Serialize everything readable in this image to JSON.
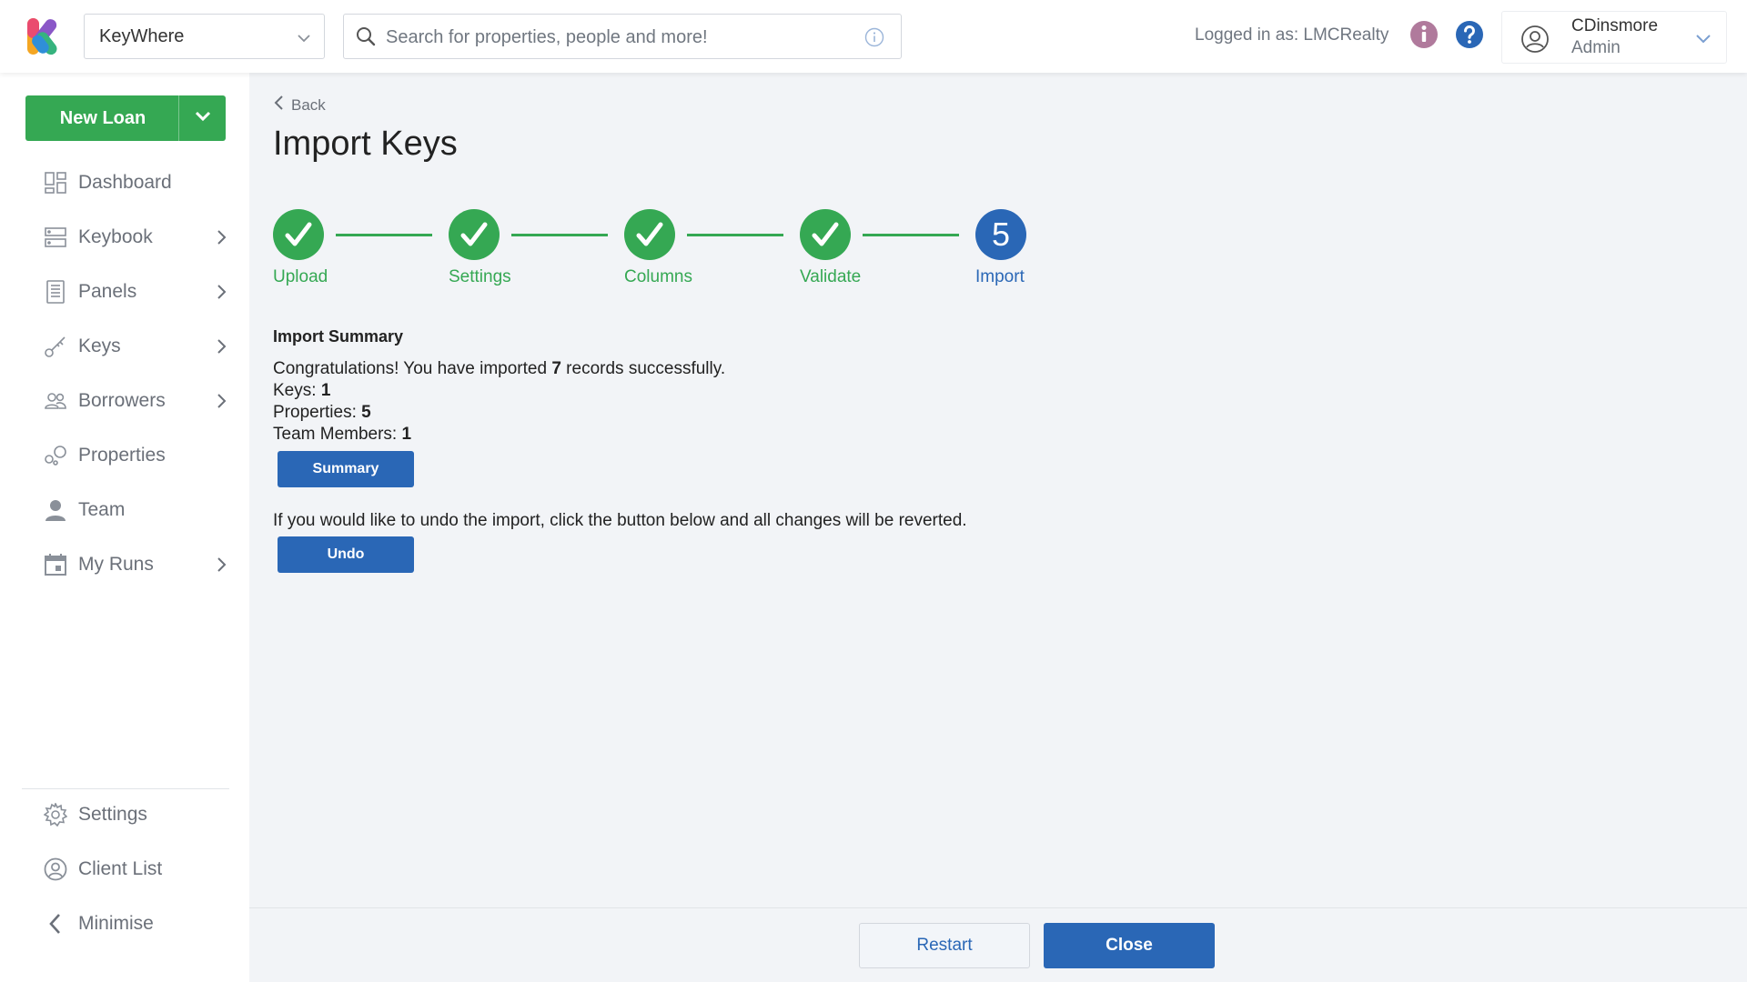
{
  "colors": {
    "brand_green": "#35a853",
    "brand_blue": "#2a67b6",
    "info_purple": "#b07a9c",
    "background": "#f2f4f7"
  },
  "header": {
    "org_select_value": "KeyWhere",
    "search_placeholder": "Search for properties, people and more!",
    "logged_in_text": "Logged in as: LMCRealty",
    "user_name": "CDinsmore",
    "user_role": "Admin",
    "icons": [
      "keywhere-logo-icon",
      "chevron-down-icon",
      "search-icon",
      "info-outline-icon",
      "info-icon",
      "help-icon",
      "user-avatar-icon"
    ]
  },
  "sidebar": {
    "new_loan_label": "New Loan",
    "items": [
      {
        "label": "Dashboard",
        "icon": "dashboard-icon",
        "has_submenu": false
      },
      {
        "label": "Keybook",
        "icon": "keybook-icon",
        "has_submenu": true
      },
      {
        "label": "Panels",
        "icon": "panels-icon",
        "has_submenu": true
      },
      {
        "label": "Keys",
        "icon": "key-icon",
        "has_submenu": true
      },
      {
        "label": "Borrowers",
        "icon": "borrowers-icon",
        "has_submenu": true
      },
      {
        "label": "Properties",
        "icon": "properties-icon",
        "has_submenu": false
      },
      {
        "label": "Team",
        "icon": "team-icon",
        "has_submenu": false
      },
      {
        "label": "My Runs",
        "icon": "calendar-icon",
        "has_submenu": true
      }
    ],
    "bottom_items": [
      {
        "label": "Settings",
        "icon": "gear-icon"
      },
      {
        "label": "Client List",
        "icon": "client-list-icon"
      },
      {
        "label": "Minimise",
        "icon": "chevron-left-icon"
      }
    ]
  },
  "main": {
    "back_label": "Back",
    "title": "Import Keys",
    "steps": [
      {
        "label": "Upload",
        "status": "done"
      },
      {
        "label": "Settings",
        "status": "done"
      },
      {
        "label": "Columns",
        "status": "done"
      },
      {
        "label": "Validate",
        "status": "done"
      },
      {
        "label": "Import",
        "status": "active",
        "number": "5"
      }
    ],
    "summary": {
      "heading": "Import Summary",
      "congrats_before": "Congratulations! You have imported ",
      "record_count": "7",
      "congrats_after": " records successfully.",
      "keys_label": "Keys: ",
      "keys_value": "1",
      "properties_label": "Properties: ",
      "properties_value": "5",
      "team_label": "Team Members: ",
      "team_value": "1",
      "summary_button": "Summary"
    },
    "undo": {
      "text": "If you would like to undo the import, click the button below and all changes will be reverted.",
      "button": "Undo"
    }
  },
  "footer": {
    "restart_label": "Restart",
    "close_label": "Close"
  }
}
